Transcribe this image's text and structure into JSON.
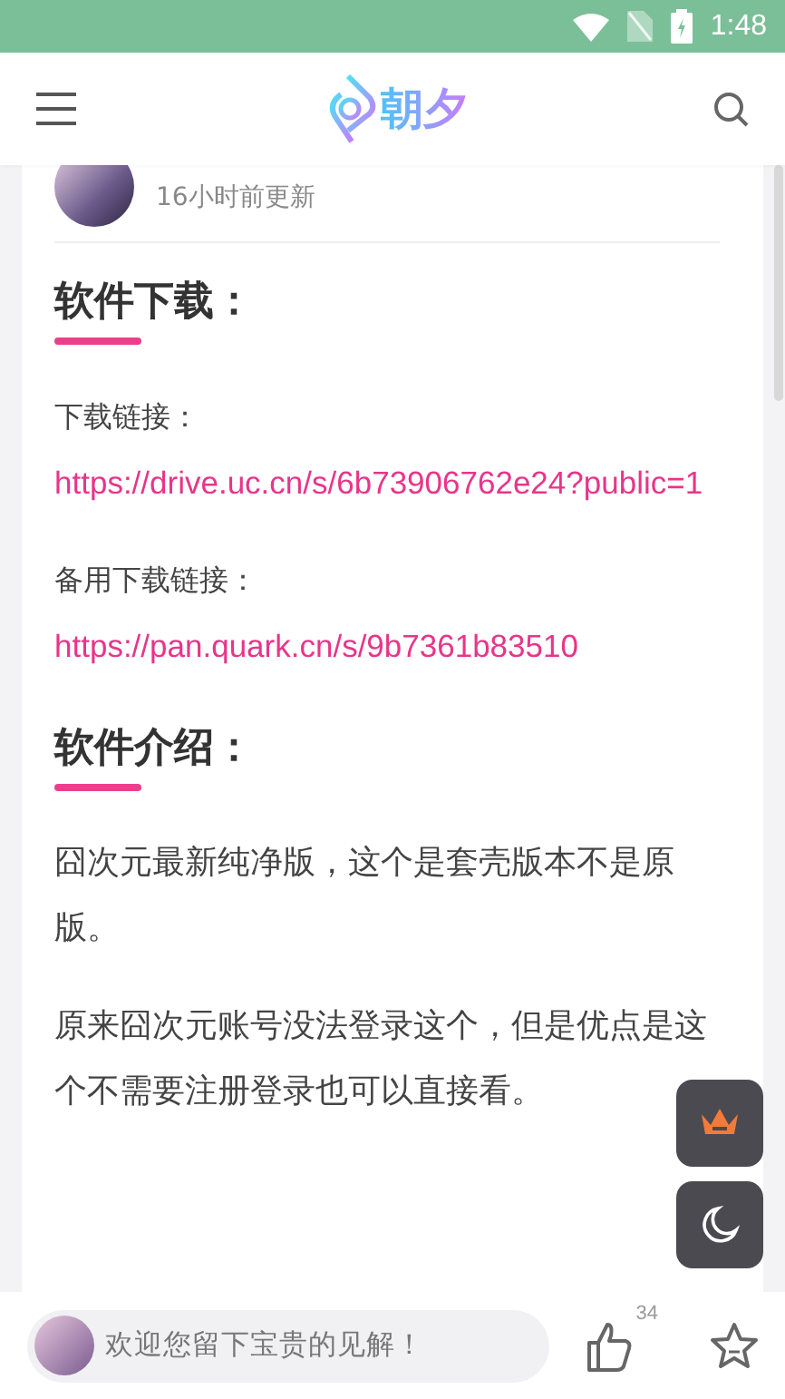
{
  "status_bar": {
    "time": "1:48"
  },
  "header": {
    "logo_text": "朝夕"
  },
  "post_meta": {
    "updated": "16小时前更新"
  },
  "sections": [
    {
      "heading": "软件下载：",
      "blocks": [
        {
          "kind": "label",
          "text": "下载链接："
        },
        {
          "kind": "link",
          "text": "https://drive.uc.cn/s/6b73906762e24?public=1"
        },
        {
          "kind": "label",
          "text": "备用下载链接："
        },
        {
          "kind": "link",
          "text": "https://pan.quark.cn/s/9b7361b83510"
        }
      ]
    },
    {
      "heading": "软件介绍：",
      "blocks": [
        {
          "kind": "paragraph",
          "text": "囧次元最新纯净版，这个是套壳版本不是原版。"
        },
        {
          "kind": "paragraph",
          "text": "原来囧次元账号没法登录这个，但是优点是这个不需要注册登录也可以直接看。"
        }
      ]
    }
  ],
  "comment_bar": {
    "placeholder": "欢迎您留下宝贵的见解！",
    "like_count": "34"
  }
}
